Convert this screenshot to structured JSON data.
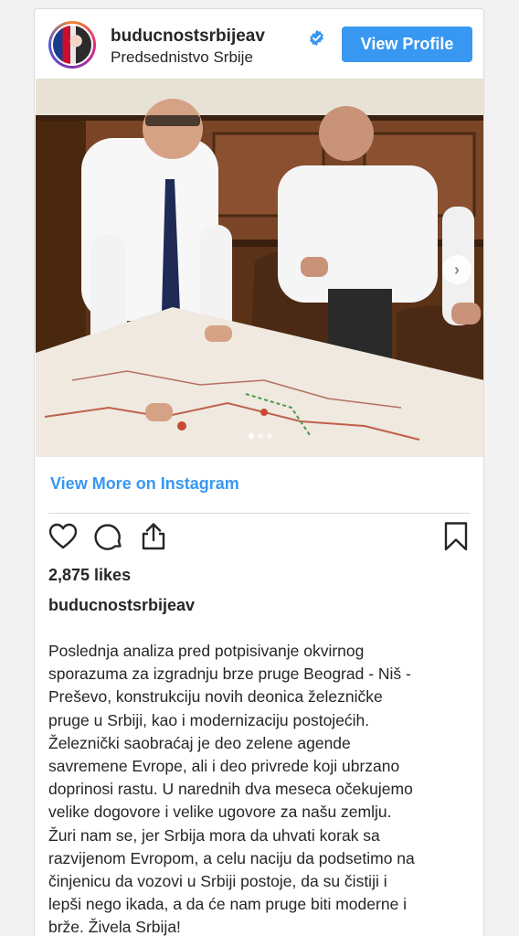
{
  "post": {
    "username": "buducnostsrbijeav",
    "subtitle": "Predsednistvo Srbije",
    "view_profile_label": "View Profile",
    "view_more_label": "View More on Instagram",
    "likes": "2,875 likes",
    "caption_username": "buducnostsrbijeav",
    "caption": "Poslednja analiza pred potpisivanje okvirnog\nsporazuma za izgradnju brze pruge Beograd - Niš -\nPreševo, konstrukciju novih deonica železničke\npruge u Srbiji, kao i modernizaciju postojećih.\nŽeleznički saobraćaj je deo zelene agende\nsavremene Evrope, ali i deo privrede koji ubrzano\ndoprinosi rastu. U narednih dva meseca očekujemo\nvelike dogovore i velike ugovore za našu zemlju.\nŽuri nam se, jer Srbija mora da uhvati korak sa\nrazvijenom Evropom, a celu naciju da podsetimo na\nčinjenicu da vozovi u Srbiji postoje, da su čistiji i\nlepši nego ikada, a da će nam pruge biti moderne i\nbrže. Živela Srbija!",
    "carousel": {
      "total": 3,
      "active": 1
    }
  },
  "icons": {
    "verified": "verified-badge-icon",
    "like": "heart-icon",
    "comment": "comment-icon",
    "share": "share-icon",
    "save": "bookmark-icon",
    "next": "chevron-right-icon"
  },
  "colors": {
    "accent": "#3897f0",
    "text": "#262626",
    "border": "#dbdbdb"
  }
}
